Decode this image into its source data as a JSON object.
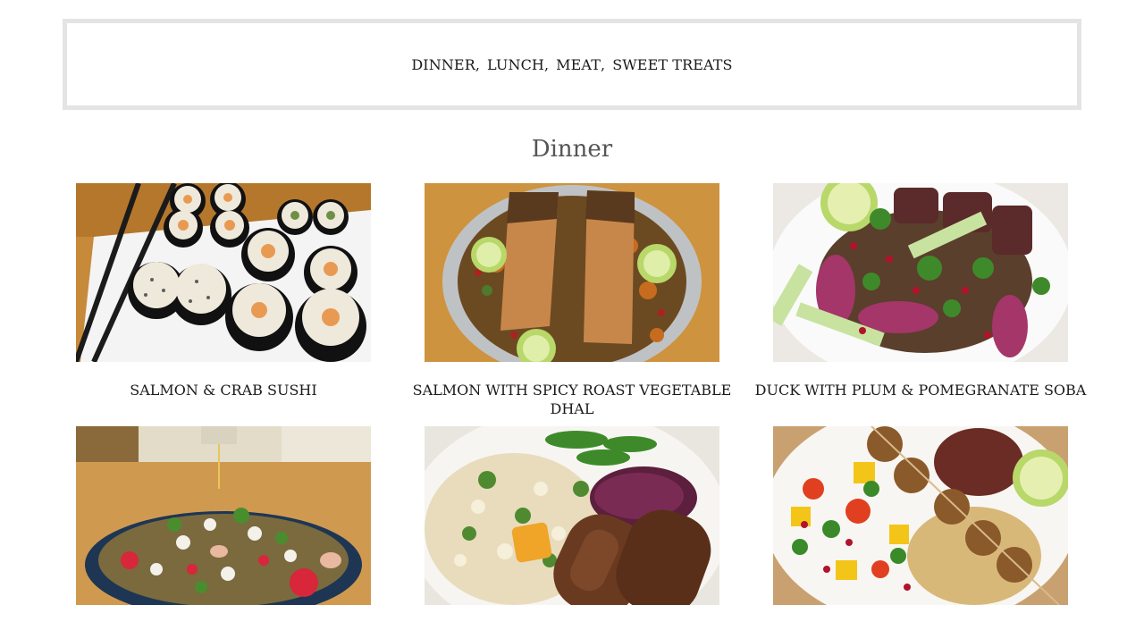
{
  "categories": [
    {
      "label": "DINNER",
      "sep": ","
    },
    {
      "label": "LUNCH",
      "sep": ","
    },
    {
      "label": "MEAT",
      "sep": ","
    },
    {
      "label": "SWEET TREATS",
      "sep": ""
    }
  ],
  "section": {
    "title": "Dinner"
  },
  "recipes": [
    {
      "title": "SALMON & CRAB SUSHI"
    },
    {
      "title": "SALMON WITH SPICY ROAST VEGETABLE DHAL"
    },
    {
      "title": "DUCK WITH PLUM & POMEGRANATE SOBA"
    },
    {
      "title": ""
    },
    {
      "title": ""
    },
    {
      "title": ""
    }
  ]
}
